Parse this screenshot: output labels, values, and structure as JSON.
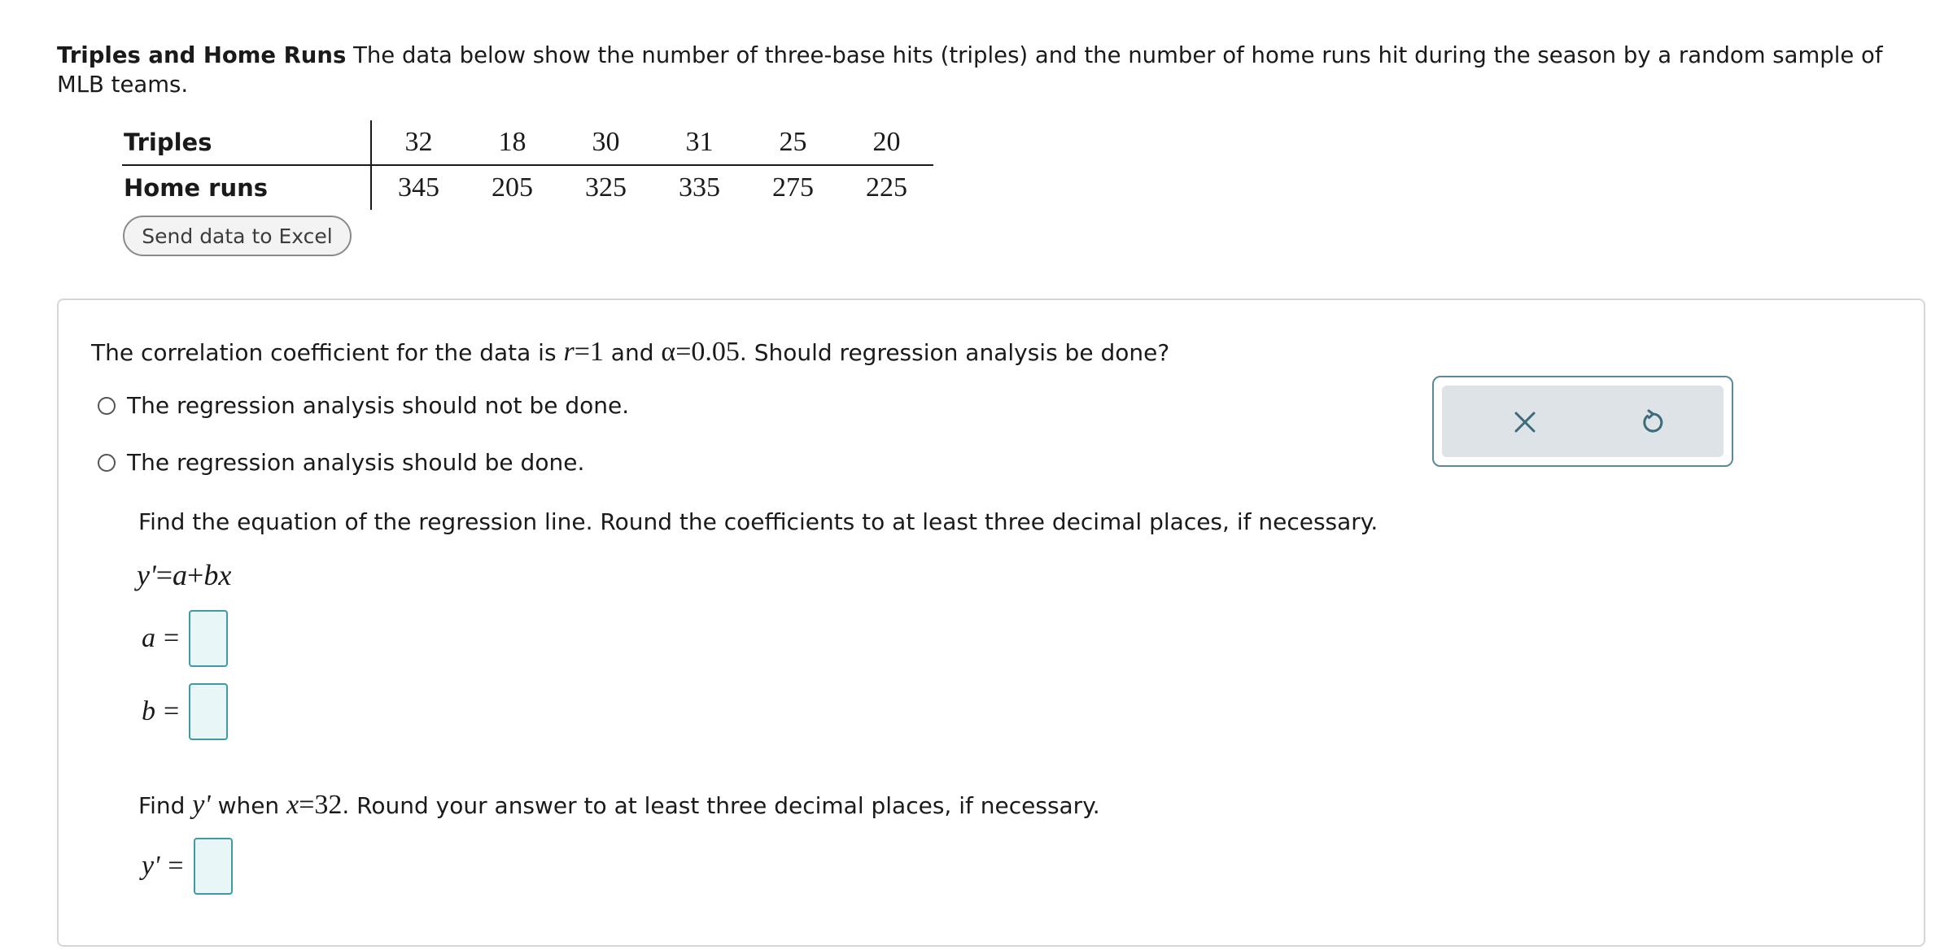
{
  "problem": {
    "title": "Triples and Home Runs",
    "description": "The data below show the number of three-base hits (triples) and the number of home runs hit during the season by a random sample of MLB teams."
  },
  "table": {
    "row1_label": "Triples",
    "row2_label": "Home runs",
    "triples": [
      "32",
      "18",
      "30",
      "31",
      "25",
      "20"
    ],
    "home_runs": [
      "345",
      "205",
      "325",
      "335",
      "275",
      "225"
    ]
  },
  "excel_button": "Send data to Excel",
  "question1": {
    "prefix": "The correlation coefficient for the data is",
    "r_var": "r",
    "r_eq": "=1",
    "middle": "and",
    "alpha_expr": "α=0.05",
    "suffix": ". Should regression analysis be done?"
  },
  "options": [
    "The regression analysis should not be done.",
    "The regression analysis should be done."
  ],
  "question2": {
    "text": "Find the equation of the regression line. Round the coefficients to at least three decimal places, if necessary.",
    "equation": {
      "lhs": "y'",
      "eq": "=",
      "a": "a",
      "plus": "+",
      "bx": "bx"
    }
  },
  "answers": {
    "a_label": "a",
    "b_label": "b",
    "y_label": "y'",
    "equals": "=",
    "a_value": "",
    "b_value": "",
    "y_value": ""
  },
  "question3": {
    "prefix": "Find",
    "y_var": "y'",
    "middle": "when",
    "x_var": "x",
    "x_eq": "=32",
    "suffix": ". Round your answer to at least three decimal places, if necessary."
  },
  "toolbar": {
    "clear_icon": "close-icon",
    "reset_icon": "undo-icon",
    "icon_color": "#3c6b7a"
  },
  "colors": {
    "input_border": "#3f9aa6",
    "input_fill": "#e8f6f8",
    "panel_border": "#d6d6d6"
  }
}
